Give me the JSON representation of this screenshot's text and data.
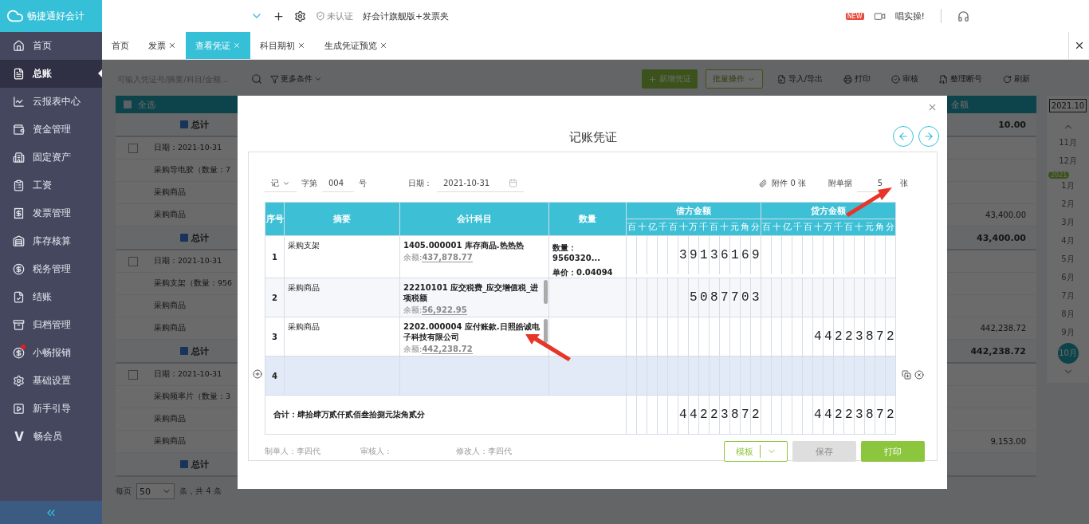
{
  "app": {
    "name": "畅捷通好会计"
  },
  "topbar": {
    "cert": "未认证",
    "edition": "好会计旗舰版+发票夹",
    "promo_badge": "NEW",
    "promo": "唱实操!"
  },
  "sidebar": {
    "items": [
      {
        "label": "首页",
        "selected": false,
        "dot": false
      },
      {
        "label": "总账",
        "selected": true,
        "dot": false
      },
      {
        "label": "云报表中心",
        "selected": false,
        "dot": false
      },
      {
        "label": "资金管理",
        "selected": false,
        "dot": false
      },
      {
        "label": "固定资产",
        "selected": false,
        "dot": false
      },
      {
        "label": "工资",
        "selected": false,
        "dot": false
      },
      {
        "label": "发票管理",
        "selected": false,
        "dot": false
      },
      {
        "label": "库存核算",
        "selected": false,
        "dot": false
      },
      {
        "label": "税务管理",
        "selected": false,
        "dot": false
      },
      {
        "label": "结账",
        "selected": false,
        "dot": false
      },
      {
        "label": "归档管理",
        "selected": false,
        "dot": false
      },
      {
        "label": "小畅报销",
        "selected": false,
        "dot": true
      },
      {
        "label": "基础设置",
        "selected": false,
        "dot": false
      },
      {
        "label": "新手引导",
        "selected": false,
        "dot": false
      },
      {
        "label": "畅会员",
        "icon_text": "V",
        "selected": false,
        "dot": false
      }
    ]
  },
  "tabs": [
    {
      "label": "首页",
      "closable": false,
      "selected": false
    },
    {
      "label": "发票",
      "closable": true,
      "selected": false
    },
    {
      "label": "查看凭证",
      "closable": true,
      "selected": true
    },
    {
      "label": "科目期初",
      "closable": true,
      "selected": false
    },
    {
      "label": "生成凭证预览",
      "closable": true,
      "selected": false
    }
  ],
  "toolbar": {
    "search_placeholder": "可输入凭证号/摘要/科目/金额...",
    "more": "更多条件",
    "buttons": [
      {
        "label": "新增凭证",
        "kind": "primary"
      },
      {
        "label": "批量操作",
        "kind": "outline"
      },
      {
        "label": "导入/导出",
        "kind": "plain"
      },
      {
        "label": "打印",
        "kind": "plain"
      },
      {
        "label": "审核",
        "kind": "plain"
      },
      {
        "label": "整理断号",
        "kind": "plain"
      },
      {
        "label": "刷新",
        "kind": "plain"
      }
    ]
  },
  "list": {
    "select_all": "全选",
    "select_all_checked": false,
    "amount_header": "金额",
    "rows": [
      {
        "kind": "total",
        "label": "总计",
        "amount": "10.00"
      },
      {
        "kind": "date",
        "label": "日期：2021-10-31",
        "checked": false
      },
      {
        "kind": "line",
        "label": "采购导电胶（数量：7"
      },
      {
        "kind": "line",
        "label": "采购商品"
      },
      {
        "kind": "line",
        "label": "采购商品",
        "amount": "43,400.00"
      },
      {
        "kind": "total",
        "label": "总计",
        "amount": "43,400.00"
      },
      {
        "kind": "date",
        "label": "日期：2021-10-31",
        "checked": false
      },
      {
        "kind": "line",
        "label": "采购支架（数量：956"
      },
      {
        "kind": "line",
        "label": "采购商品"
      },
      {
        "kind": "line",
        "label": "采购商品",
        "amount": "442,238.72"
      },
      {
        "kind": "total",
        "label": "总计",
        "amount": "442,238.72"
      },
      {
        "kind": "date",
        "label": "日期：2021-10-31",
        "checked": false
      },
      {
        "kind": "line",
        "label": "采购频率片（数量：3"
      },
      {
        "kind": "line",
        "label": "采购商品"
      },
      {
        "kind": "line",
        "label": "采购商品",
        "amount": "9,153.00"
      },
      {
        "kind": "total",
        "label": "总计"
      }
    ]
  },
  "pagination": {
    "label": "每页",
    "per_page": "50",
    "summary": "条，共 4 条"
  },
  "month_picker": {
    "period": "2021.10",
    "year_badge": "2021",
    "months": [
      {
        "label": "11月",
        "selected": false
      },
      {
        "label": "12月",
        "selected": false
      },
      {
        "label": "1月",
        "selected": false
      },
      {
        "label": "2月",
        "selected": false
      },
      {
        "label": "3月",
        "selected": false
      },
      {
        "label": "4月",
        "selected": false
      },
      {
        "label": "5月",
        "selected": false
      },
      {
        "label": "6月",
        "selected": false
      },
      {
        "label": "7月",
        "selected": false
      },
      {
        "label": "8月",
        "selected": false
      },
      {
        "label": "9月",
        "selected": false
      },
      {
        "label": "10月",
        "selected": true
      }
    ]
  },
  "voucher": {
    "title": "记账凭证",
    "type": "记",
    "word_label": "字第",
    "number": "004",
    "number_suffix": "号",
    "date_label": "日期：",
    "date": "2021-10-31",
    "attachments": "附件 0 张",
    "docs_label": "附单据",
    "docs": "5",
    "docs_unit": "张",
    "columns": {
      "no": "序号",
      "summary": "摘要",
      "account": "会计科目",
      "quantity": "数量",
      "debit": "借方金额",
      "credit": "贷方金额"
    },
    "debit_units": [
      "百",
      "十",
      "亿",
      "千",
      "百",
      "十",
      "万",
      "千",
      "百",
      "十",
      "元",
      "角",
      "分"
    ],
    "credit_units": [
      "百",
      "十",
      "亿",
      "千",
      "百",
      "十",
      "万",
      "千",
      "百",
      "十",
      "元",
      "角",
      "分"
    ],
    "rows": [
      {
        "no": "1",
        "summary": "采购支架",
        "account": "1405.000001 库存商品.热热热",
        "balance_label": "余额:",
        "balance": "437,878.77",
        "quantity": "数量：9560320...",
        "unit_price": "单价：0.04094",
        "debit": "39136169",
        "hovered": false
      },
      {
        "no": "2",
        "summary": "采购商品",
        "account": "22210101 应交税费_应交增值税_进项税额",
        "balance_label": "余额:",
        "balance": "56,922.95",
        "debit": "5087703",
        "hovered": false
      },
      {
        "no": "3",
        "summary": "采购商品",
        "account": "2202.000004 应付账款.日照皓诚电子科技有限公司",
        "balance_label": "余额:",
        "balance": "442,238.72",
        "credit": "44223872",
        "hovered": false
      },
      {
        "no": "4",
        "hovered": true
      }
    ],
    "total": {
      "label": "合计：肆拾肆万贰仟贰佰叁拾捌元柒角贰分",
      "debit": "44223872",
      "credit": "44223872"
    },
    "signatures": [
      "制单人：李四代",
      "审核人：",
      "修改人：李四代"
    ],
    "buttons": [
      {
        "label": "模板",
        "kind": "template"
      },
      {
        "label": "保存",
        "kind": "disabled"
      },
      {
        "label": "打印",
        "kind": "primary"
      }
    ]
  }
}
